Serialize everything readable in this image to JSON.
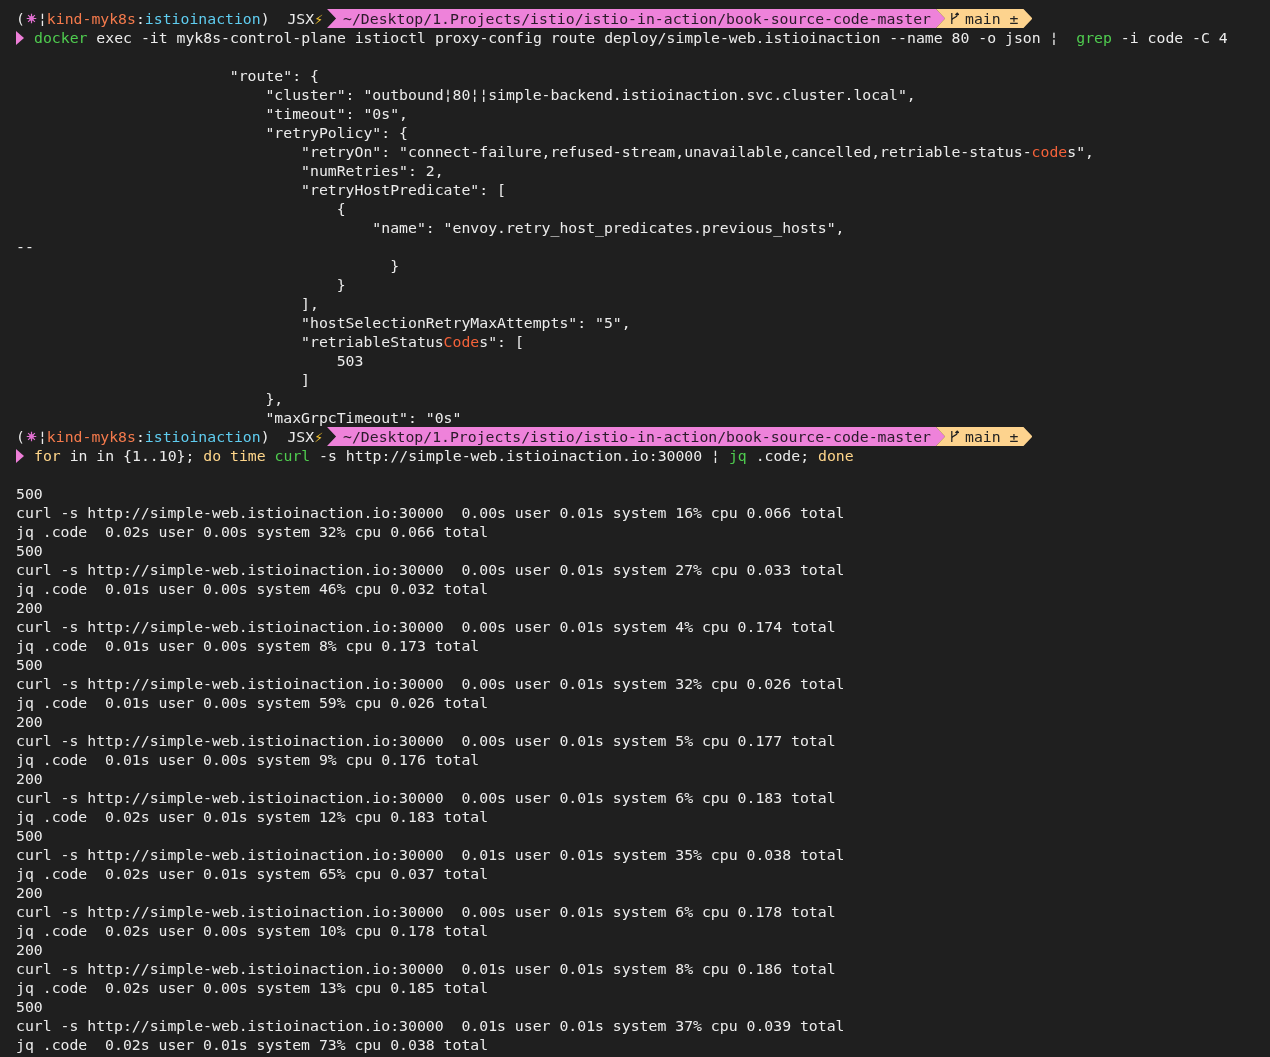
{
  "terminal": {
    "lines": [
      {
        "kind": "prompt",
        "context": [
          {
            "kind": "plain",
            "text": "("
          },
          {
            "kind": "k8s"
          },
          {
            "kind": "plain",
            "text": "¦"
          },
          {
            "kind": "cluster",
            "text": "kind-myk8s"
          },
          {
            "kind": "plain",
            "text": ":"
          },
          {
            "kind": "namespace",
            "text": "istioinaction"
          },
          {
            "kind": "plain",
            "text": ")  JSX"
          },
          {
            "kind": "bolt",
            "text": "⚡"
          }
        ],
        "path": "~/Desktop/1.Projects/istio/istio-in-action/book-source-code-master",
        "branch": "main ±"
      },
      {
        "kind": "command",
        "segments": [
          {
            "kind": "command",
            "text": "docker"
          },
          {
            "kind": "plain",
            "text": " exec -it myk8s-control-plane istioctl proxy-config route deploy/simple-web.istioinaction --name 80 -o json ¦  "
          },
          {
            "kind": "command",
            "text": "grep"
          },
          {
            "kind": "plain",
            "text": " -i code -C 4"
          }
        ]
      },
      {
        "kind": "blank"
      },
      {
        "kind": "text",
        "text": "                        \"route\": {"
      },
      {
        "kind": "text",
        "text": "                            \"cluster\": \"outbound¦80¦¦simple-backend.istioinaction.svc.cluster.local\","
      },
      {
        "kind": "text",
        "text": "                            \"timeout\": \"0s\","
      },
      {
        "kind": "text",
        "text": "                            \"retryPolicy\": {"
      },
      {
        "kind": "rich",
        "segments": [
          {
            "kind": "plain",
            "text": "                                \"retryOn\": \"connect-failure,refused-stream,unavailable,cancelled,retriable-status-"
          },
          {
            "kind": "match",
            "text": "code"
          },
          {
            "kind": "plain",
            "text": "s\","
          }
        ]
      },
      {
        "kind": "text",
        "text": "                                \"numRetries\": 2,"
      },
      {
        "kind": "text",
        "text": "                                \"retryHostPredicate\": ["
      },
      {
        "kind": "text",
        "text": "                                    {"
      },
      {
        "kind": "text",
        "text": "                                        \"name\": \"envoy.retry_host_predicates.previous_hosts\","
      },
      {
        "kind": "text",
        "text": "--"
      },
      {
        "kind": "text",
        "text": "                                          }"
      },
      {
        "kind": "text",
        "text": "                                    }"
      },
      {
        "kind": "text",
        "text": "                                ],"
      },
      {
        "kind": "text",
        "text": "                                \"hostSelectionRetryMaxAttempts\": \"5\","
      },
      {
        "kind": "rich",
        "segments": [
          {
            "kind": "plain",
            "text": "                                \"retriableStatus"
          },
          {
            "kind": "match",
            "text": "Code"
          },
          {
            "kind": "plain",
            "text": "s\": ["
          }
        ]
      },
      {
        "kind": "text",
        "text": "                                    503"
      },
      {
        "kind": "text",
        "text": "                                ]"
      },
      {
        "kind": "text",
        "text": "                            },"
      },
      {
        "kind": "text",
        "text": "                            \"maxGrpcTimeout\": \"0s\""
      },
      {
        "kind": "prompt",
        "context": [
          {
            "kind": "plain",
            "text": "("
          },
          {
            "kind": "k8s"
          },
          {
            "kind": "plain",
            "text": "¦"
          },
          {
            "kind": "cluster",
            "text": "kind-myk8s"
          },
          {
            "kind": "plain",
            "text": ":"
          },
          {
            "kind": "namespace",
            "text": "istioinaction"
          },
          {
            "kind": "plain",
            "text": ")  JSX"
          },
          {
            "kind": "bolt",
            "text": "⚡"
          }
        ],
        "path": "~/Desktop/1.Projects/istio/istio-in-action/book-source-code-master",
        "branch": "main ±"
      },
      {
        "kind": "command",
        "segments": [
          {
            "kind": "keyword",
            "text": "for"
          },
          {
            "kind": "plain",
            "text": " in in {1..10}; "
          },
          {
            "kind": "keyword",
            "text": "do time "
          },
          {
            "kind": "command",
            "text": "curl"
          },
          {
            "kind": "plain",
            "text": " -s http://simple-web.istioinaction.io:30000 ¦ "
          },
          {
            "kind": "command",
            "text": "jq"
          },
          {
            "kind": "plain",
            "text": " .code; "
          },
          {
            "kind": "keyword",
            "text": "done"
          }
        ]
      },
      {
        "kind": "blank"
      },
      {
        "kind": "text",
        "text": "500"
      },
      {
        "kind": "text",
        "text": "curl -s http://simple-web.istioinaction.io:30000  0.00s user 0.01s system 16% cpu 0.066 total"
      },
      {
        "kind": "text",
        "text": "jq .code  0.02s user 0.00s system 32% cpu 0.066 total"
      },
      {
        "kind": "text",
        "text": "500"
      },
      {
        "kind": "text",
        "text": "curl -s http://simple-web.istioinaction.io:30000  0.00s user 0.01s system 27% cpu 0.033 total"
      },
      {
        "kind": "text",
        "text": "jq .code  0.01s user 0.00s system 46% cpu 0.032 total"
      },
      {
        "kind": "text",
        "text": "200"
      },
      {
        "kind": "text",
        "text": "curl -s http://simple-web.istioinaction.io:30000  0.00s user 0.01s system 4% cpu 0.174 total"
      },
      {
        "kind": "text",
        "text": "jq .code  0.01s user 0.00s system 8% cpu 0.173 total"
      },
      {
        "kind": "text",
        "text": "500"
      },
      {
        "kind": "text",
        "text": "curl -s http://simple-web.istioinaction.io:30000  0.00s user 0.01s system 32% cpu 0.026 total"
      },
      {
        "kind": "text",
        "text": "jq .code  0.01s user 0.00s system 59% cpu 0.026 total"
      },
      {
        "kind": "text",
        "text": "200"
      },
      {
        "kind": "text",
        "text": "curl -s http://simple-web.istioinaction.io:30000  0.00s user 0.01s system 5% cpu 0.177 total"
      },
      {
        "kind": "text",
        "text": "jq .code  0.01s user 0.00s system 9% cpu 0.176 total"
      },
      {
        "kind": "text",
        "text": "200"
      },
      {
        "kind": "text",
        "text": "curl -s http://simple-web.istioinaction.io:30000  0.00s user 0.01s system 6% cpu 0.183 total"
      },
      {
        "kind": "text",
        "text": "jq .code  0.02s user 0.01s system 12% cpu 0.183 total"
      },
      {
        "kind": "text",
        "text": "500"
      },
      {
        "kind": "text",
        "text": "curl -s http://simple-web.istioinaction.io:30000  0.01s user 0.01s system 35% cpu 0.038 total"
      },
      {
        "kind": "text",
        "text": "jq .code  0.02s user 0.01s system 65% cpu 0.037 total"
      },
      {
        "kind": "text",
        "text": "200"
      },
      {
        "kind": "text",
        "text": "curl -s http://simple-web.istioinaction.io:30000  0.00s user 0.01s system 6% cpu 0.178 total"
      },
      {
        "kind": "text",
        "text": "jq .code  0.02s user 0.00s system 10% cpu 0.178 total"
      },
      {
        "kind": "text",
        "text": "200"
      },
      {
        "kind": "text",
        "text": "curl -s http://simple-web.istioinaction.io:30000  0.01s user 0.01s system 8% cpu 0.186 total"
      },
      {
        "kind": "text",
        "text": "jq .code  0.02s user 0.00s system 13% cpu 0.185 total"
      },
      {
        "kind": "text",
        "text": "500"
      },
      {
        "kind": "text",
        "text": "curl -s http://simple-web.istioinaction.io:30000  0.01s user 0.01s system 37% cpu 0.039 total"
      },
      {
        "kind": "text",
        "text": "jq .code  0.02s user 0.01s system 73% cpu 0.038 total"
      }
    ]
  }
}
